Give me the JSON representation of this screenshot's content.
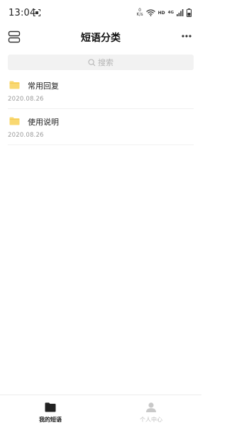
{
  "status_bar": {
    "time": "13:04",
    "net_speed_value": "0",
    "net_speed_unit": "K/s",
    "hd": "HD",
    "network_type": "4G",
    "icons": [
      "screenshot-icon",
      "wifi-icon",
      "signal-icon",
      "battery-icon"
    ]
  },
  "header": {
    "title": "短语分类",
    "left_icon": "menu-toggle-icon",
    "right_icon": "more-icon"
  },
  "search": {
    "placeholder": "搜索",
    "icon": "search-icon"
  },
  "categories": [
    {
      "name": "常用回复",
      "date": "2020.08.26",
      "icon": "folder-icon"
    },
    {
      "name": "使用说明",
      "date": "2020.08.26",
      "icon": "folder-icon"
    }
  ],
  "tabs": [
    {
      "label": "我的短语",
      "icon": "folder-tab-icon",
      "active": true
    },
    {
      "label": "个人中心",
      "icon": "person-icon",
      "active": false
    }
  ],
  "colors": {
    "folder": "#f9d871",
    "search_bg": "#f2f2f2",
    "inactive_tab": "#bcbcbc",
    "active_tab": "#222222"
  }
}
